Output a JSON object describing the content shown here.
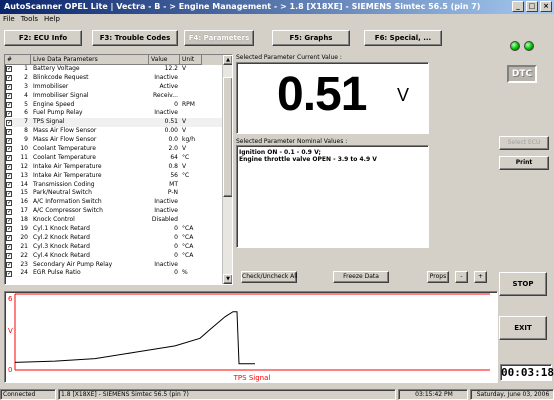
{
  "window": {
    "title": "AutoScanner OPEL Lite  |  Vectra - B  - > Engine Management - > 1.8 [X18XE] - SIEMENS Simtec 56.5 (pin 7)",
    "minimize": "_",
    "maximize": "□",
    "close": "×"
  },
  "menu": [
    "File",
    "Tools",
    "Help"
  ],
  "function_buttons": [
    {
      "label": "F2:  ECU Info"
    },
    {
      "label": "F3:  Trouble Codes"
    },
    {
      "label": "F4:  Parameters"
    },
    {
      "label": "F5:  Graphs"
    },
    {
      "label": "F6:  Special, ..."
    }
  ],
  "dtc_label": "DTC",
  "table": {
    "headers": [
      "#",
      "Live Data Parameters",
      "Value",
      "Unit"
    ],
    "rows": [
      {
        "n": "1",
        "name": "Battery Voltage",
        "value": "12.2",
        "unit": "V"
      },
      {
        "n": "2",
        "name": "Blinkcode Request",
        "value": "Inactive",
        "unit": ""
      },
      {
        "n": "3",
        "name": "Immobiliser",
        "value": "Active",
        "unit": ""
      },
      {
        "n": "4",
        "name": "Immobiliser Signal",
        "value": "Receiv...",
        "unit": ""
      },
      {
        "n": "5",
        "name": "Engine Speed",
        "value": "0",
        "unit": "RPM"
      },
      {
        "n": "6",
        "name": "Fuel Pump Relay",
        "value": "Inactive",
        "unit": ""
      },
      {
        "n": "7",
        "name": "TPS Signal",
        "value": "0.51",
        "unit": "V"
      },
      {
        "n": "8",
        "name": "Mass Air Flow Sensor",
        "value": "0.00",
        "unit": "V"
      },
      {
        "n": "9",
        "name": "Mass Air Flow Sensor",
        "value": "0.0",
        "unit": "kg/h"
      },
      {
        "n": "10",
        "name": "Coolant Temperature",
        "value": "2.0",
        "unit": "V"
      },
      {
        "n": "11",
        "name": "Coolant Temperature",
        "value": "64",
        "unit": "°C"
      },
      {
        "n": "12",
        "name": "Intake Air Temperature",
        "value": "0.8",
        "unit": "V"
      },
      {
        "n": "13",
        "name": "Intake Air Temperature",
        "value": "56",
        "unit": "°C"
      },
      {
        "n": "14",
        "name": "Transmission Coding",
        "value": "MT",
        "unit": ""
      },
      {
        "n": "15",
        "name": "Park/Neutral Switch",
        "value": "P-N",
        "unit": ""
      },
      {
        "n": "16",
        "name": "A/C Information Switch",
        "value": "Inactive",
        "unit": ""
      },
      {
        "n": "17",
        "name": "A/C Compressor Switch",
        "value": "Inactive",
        "unit": ""
      },
      {
        "n": "18",
        "name": "Knock Control",
        "value": "Disabled",
        "unit": ""
      },
      {
        "n": "19",
        "name": "Cyl.1 Knock Retard",
        "value": "0",
        "unit": "°CA"
      },
      {
        "n": "20",
        "name": "Cyl.2 Knock Retard",
        "value": "0",
        "unit": "°CA"
      },
      {
        "n": "21",
        "name": "Cyl.3 Knock Retard",
        "value": "0",
        "unit": "°CA"
      },
      {
        "n": "22",
        "name": "Cyl.4 Knock Retard",
        "value": "0",
        "unit": "°CA"
      },
      {
        "n": "23",
        "name": "Secondary Air Pump Relay",
        "value": "Inactive",
        "unit": ""
      },
      {
        "n": "24",
        "name": "EGR Pulse Ratio",
        "value": "0",
        "unit": "%"
      }
    ]
  },
  "selected": {
    "current_label": "Selected Parameter Current Value :",
    "value": "0.51",
    "unit": "V",
    "nominal_label": "Selected Parameter Nominal Values :",
    "nominal_line1": "Ignition ON  - 0.1 - 0.9 V;",
    "nominal_line2": "Engine throttle valve OPEN - 3.9 to 4.9 V"
  },
  "side_buttons": {
    "select_ecu": "Select ECU",
    "print": "Print",
    "stop": "STOP",
    "exit": "EXIT"
  },
  "controls": {
    "check_all": "Check/Uncheck All",
    "freeze": "Freeze Data",
    "props": "Props",
    "minus": "-",
    "plus": "+"
  },
  "graph": {
    "y_top": "6",
    "y_unit": "V",
    "y_bottom": "0",
    "series_label": "TPS Signal",
    "line_color": "#000000",
    "axis_color": "#ff0000"
  },
  "chart_data": {
    "type": "line",
    "title": "",
    "series": [
      {
        "name": "TPS Signal",
        "x": [
          0,
          40,
          80,
          120,
          160,
          185,
          195,
          210,
          218,
          222,
          224,
          226,
          240
        ],
        "values": [
          0.6,
          0.7,
          0.9,
          1.4,
          1.9,
          2.5,
          3.2,
          4.2,
          4.6,
          4.6,
          0.5,
          0.5,
          0.5
        ]
      }
    ],
    "ylim": [
      0,
      6
    ],
    "grid": false
  },
  "timer": "00:03:18",
  "status": {
    "connection": "Connected",
    "ecu": "1.8 [X18XE] - SIEMENS Simtec 56.5 (pin 7)",
    "time": "03:15:42 PM",
    "date": "Saturday, June 03, 2006"
  }
}
